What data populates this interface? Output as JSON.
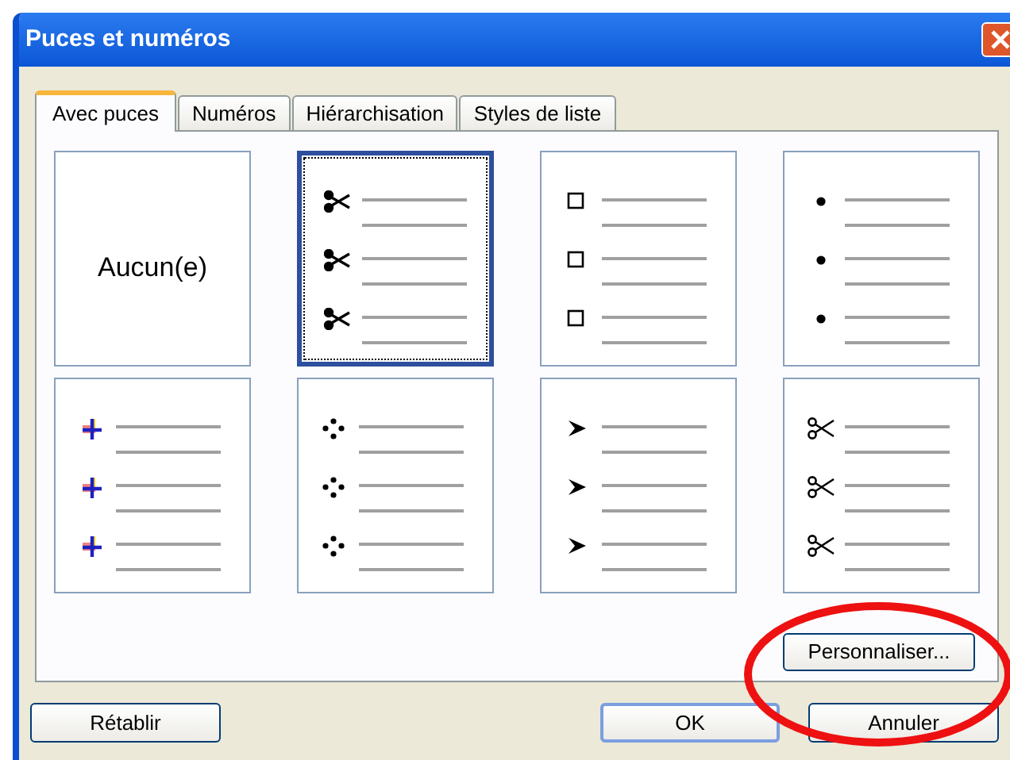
{
  "window": {
    "title": "Puces et numéros"
  },
  "tabs": [
    {
      "label": "Avec puces",
      "selected": true
    },
    {
      "label": "Numéros",
      "selected": false
    },
    {
      "label": "Hiérarchisation",
      "selected": false
    },
    {
      "label": "Styles de liste",
      "selected": false
    }
  ],
  "bullet_styles": [
    {
      "kind": "none",
      "label": "Aucun(e)",
      "selected": false
    },
    {
      "kind": "scissors",
      "selected": true
    },
    {
      "kind": "square",
      "selected": false
    },
    {
      "kind": "dot",
      "selected": false
    },
    {
      "kind": "colorplus",
      "selected": false
    },
    {
      "kind": "diamonddots",
      "selected": false
    },
    {
      "kind": "arrowhead",
      "selected": false
    },
    {
      "kind": "scissorsopen",
      "selected": false
    }
  ],
  "customize_button": "Personnaliser...",
  "buttons": [
    {
      "kind": "reset",
      "label": "Rétablir"
    },
    {
      "kind": "ok",
      "label": "OK"
    },
    {
      "kind": "cancel",
      "label": "Annuler"
    }
  ]
}
